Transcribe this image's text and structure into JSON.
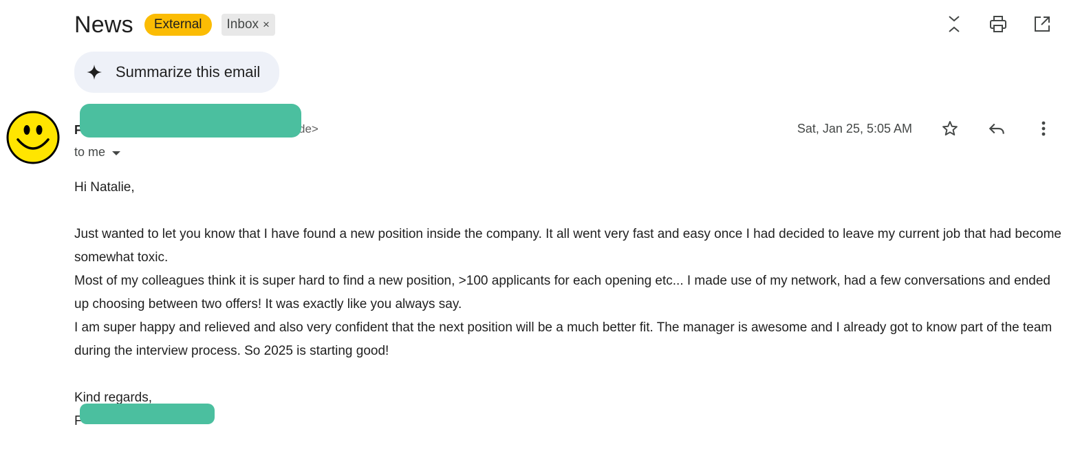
{
  "subject": "News",
  "labels": {
    "external": "External",
    "inbox": "Inbox",
    "inbox_remove": "×"
  },
  "toolbar_icons": [
    "collapse-all-icon",
    "print-icon",
    "open-in-new-window-icon"
  ],
  "summarize": {
    "label": "Summarize this email",
    "icon": "sparkle-icon"
  },
  "sender": {
    "initial": "F",
    "email_tail": "de>",
    "recipient": "to me"
  },
  "date": "Sat, Jan 25, 5:05 AM",
  "message_icons": [
    "star-icon",
    "reply-icon",
    "more-vert-icon"
  ],
  "body": {
    "greeting": "Hi Natalie,",
    "paragraphs": [
      "Just wanted to let you know that I have found a new position inside the company. It all went very fast and easy once I had decided to leave my current job that had become somewhat toxic.",
      "Most of my colleagues think it is super hard to find a new position, >100 applicants for each opening etc...  I made use of my network, had a few conversations and ended up choosing between two offers! It was exactly like you always say.",
      "I am super happy and relieved and also very confident that the next position will be a much better fit. The manager is awesome and I already got to know part of the team during the interview process. So 2025 is starting good!"
    ],
    "closing": "Kind regards,",
    "signature_initial": "F"
  },
  "colors": {
    "external_label": "#fbbc04",
    "redaction": "#4bbf9f",
    "summarize_bg": "#eef1f8",
    "avatar": "#ffe500"
  }
}
